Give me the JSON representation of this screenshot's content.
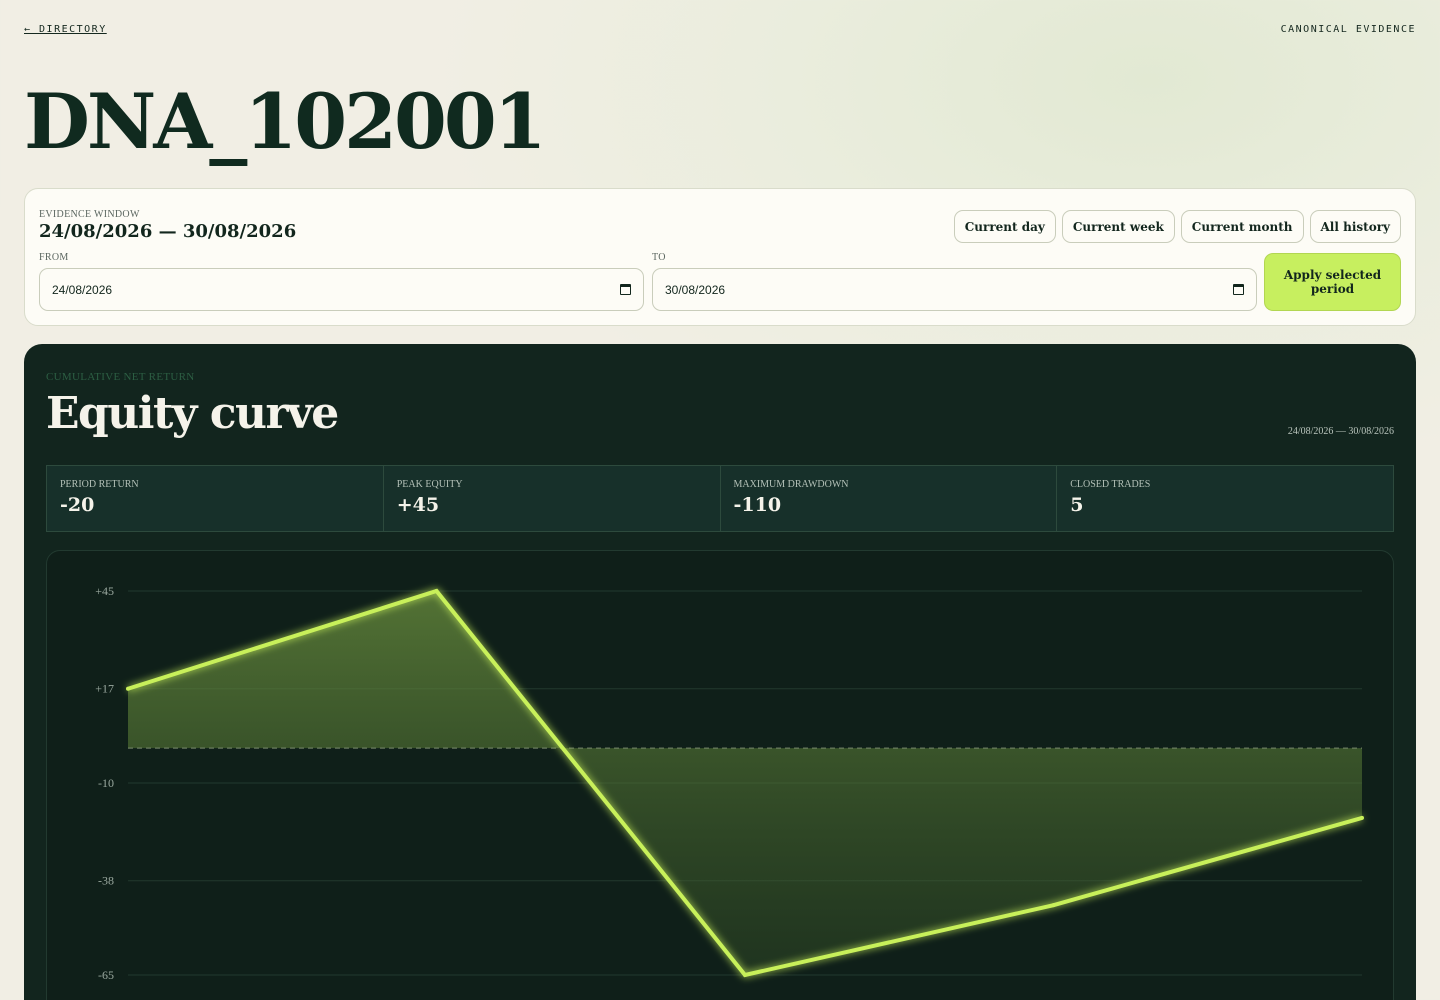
{
  "nav": {
    "back_label": "← DIRECTORY",
    "top_right": "CANONICAL EVIDENCE"
  },
  "page": {
    "title": "DNA_102001"
  },
  "evidence_window": {
    "label": "EVIDENCE WINDOW",
    "range": "24/08/2026 — 30/08/2026",
    "presets": [
      "Current day",
      "Current week",
      "Current month",
      "All history"
    ],
    "from_label": "FROM",
    "from_value": "24/08/2026",
    "to_label": "TO",
    "to_value": "30/08/2026",
    "apply_label": "Apply selected period"
  },
  "chart_section": {
    "eyebrow": "CUMULATIVE NET RETURN",
    "title": "Equity curve",
    "range": "24/08/2026 — 30/08/2026",
    "stats": [
      {
        "label": "PERIOD RETURN",
        "value": "-20"
      },
      {
        "label": "PEAK EQUITY",
        "value": "+45"
      },
      {
        "label": "MAXIMUM DRAWDOWN",
        "value": "-110"
      },
      {
        "label": "CLOSED TRADES",
        "value": "5"
      }
    ]
  },
  "colors": {
    "accent": "#c7ef5f",
    "panel": "#12251e",
    "line": "#c8f05a"
  },
  "chart_data": {
    "type": "area",
    "x": [
      0,
      1,
      2,
      3,
      4
    ],
    "values": [
      17,
      45,
      -65,
      -45,
      -20
    ],
    "baseline": 0,
    "y_ticks": [
      "+45",
      "+17",
      "-10",
      "-38",
      "-65"
    ],
    "y_tick_values": [
      45,
      17,
      -10,
      -38,
      -65
    ],
    "ylim": [
      -65,
      45
    ],
    "grid": true
  }
}
